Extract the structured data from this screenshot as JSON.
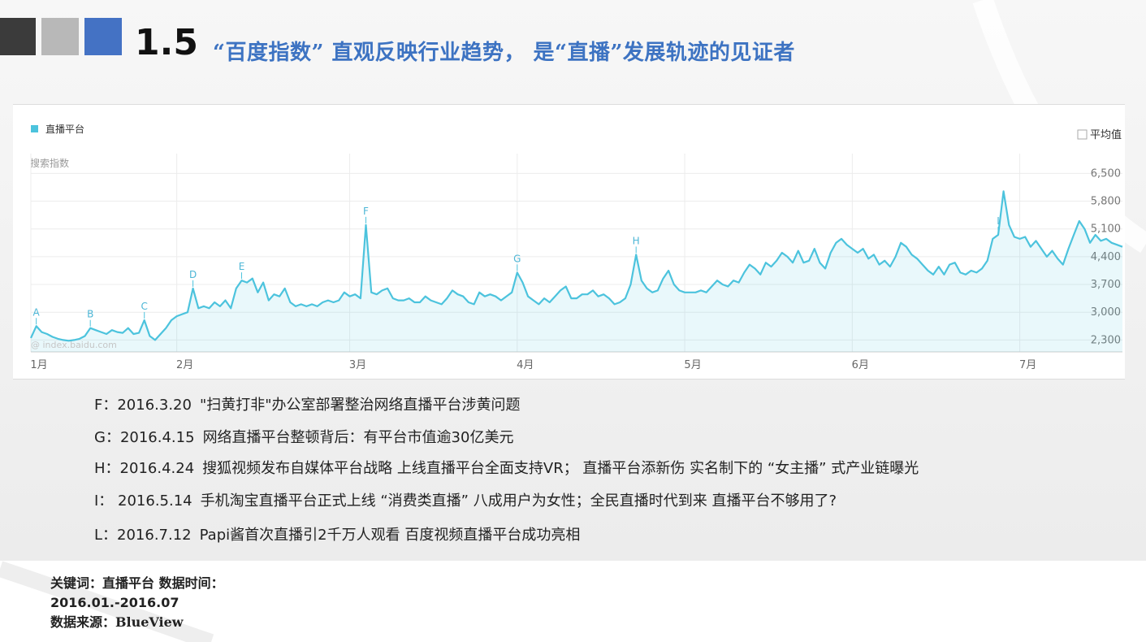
{
  "header": {
    "section_number": "1.5",
    "title": "“百度指数” 直观反映行业趋势， 是“直播”发展轨迹的见证者"
  },
  "chart_data": {
    "type": "area",
    "legend": {
      "series_label": "直播平台",
      "average_label": "平均值",
      "placement": "top-left"
    },
    "ylabel": "搜索指数",
    "watermark": "@ index.baidu.com",
    "grid": true,
    "ylim": [
      2000,
      7000
    ],
    "y_ticks": [
      6500,
      5800,
      5100,
      4400,
      3700,
      3000,
      2300
    ],
    "y_tick_labels": [
      "6,500",
      "5,800",
      "5,100",
      "4,400",
      "3,700",
      "3,000",
      "2,300"
    ],
    "x_range_days": [
      0,
      202
    ],
    "x_ticks": [
      {
        "day": 0,
        "label": "1月"
      },
      {
        "day": 27,
        "label": "2月"
      },
      {
        "day": 59,
        "label": "3月"
      },
      {
        "day": 90,
        "label": "4月"
      },
      {
        "day": 121,
        "label": "5月"
      },
      {
        "day": 152,
        "label": "6月"
      },
      {
        "day": 183,
        "label": "7月"
      }
    ],
    "series": [
      {
        "name": "直播平台",
        "color": "#4cc3dd",
        "points": [
          [
            0,
            2350
          ],
          [
            1,
            2650
          ],
          [
            2,
            2500
          ],
          [
            3,
            2450
          ],
          [
            4,
            2380
          ],
          [
            5,
            2330
          ],
          [
            6,
            2300
          ],
          [
            7,
            2280
          ],
          [
            8,
            2300
          ],
          [
            9,
            2330
          ],
          [
            10,
            2400
          ],
          [
            11,
            2600
          ],
          [
            12,
            2550
          ],
          [
            13,
            2500
          ],
          [
            14,
            2450
          ],
          [
            15,
            2550
          ],
          [
            16,
            2500
          ],
          [
            17,
            2480
          ],
          [
            18,
            2600
          ],
          [
            19,
            2450
          ],
          [
            20,
            2480
          ],
          [
            21,
            2800
          ],
          [
            22,
            2400
          ],
          [
            23,
            2300
          ],
          [
            24,
            2450
          ],
          [
            25,
            2600
          ],
          [
            26,
            2800
          ],
          [
            27,
            2900
          ],
          [
            28,
            2950
          ],
          [
            29,
            3000
          ],
          [
            30,
            3600
          ],
          [
            31,
            3100
          ],
          [
            32,
            3150
          ],
          [
            33,
            3100
          ],
          [
            34,
            3250
          ],
          [
            35,
            3150
          ],
          [
            36,
            3300
          ],
          [
            37,
            3100
          ],
          [
            38,
            3600
          ],
          [
            39,
            3800
          ],
          [
            40,
            3750
          ],
          [
            41,
            3850
          ],
          [
            42,
            3500
          ],
          [
            43,
            3750
          ],
          [
            44,
            3300
          ],
          [
            45,
            3450
          ],
          [
            46,
            3400
          ],
          [
            47,
            3600
          ],
          [
            48,
            3250
          ],
          [
            49,
            3150
          ],
          [
            50,
            3200
          ],
          [
            51,
            3150
          ],
          [
            52,
            3200
          ],
          [
            53,
            3150
          ],
          [
            54,
            3250
          ],
          [
            55,
            3300
          ],
          [
            56,
            3250
          ],
          [
            57,
            3300
          ],
          [
            58,
            3500
          ],
          [
            59,
            3400
          ],
          [
            60,
            3450
          ],
          [
            61,
            3350
          ],
          [
            62,
            5200
          ],
          [
            63,
            3500
          ],
          [
            64,
            3450
          ],
          [
            65,
            3550
          ],
          [
            66,
            3600
          ],
          [
            67,
            3350
          ],
          [
            68,
            3300
          ],
          [
            69,
            3300
          ],
          [
            70,
            3350
          ],
          [
            71,
            3250
          ],
          [
            72,
            3250
          ],
          [
            73,
            3400
          ],
          [
            74,
            3300
          ],
          [
            75,
            3250
          ],
          [
            76,
            3200
          ],
          [
            77,
            3350
          ],
          [
            78,
            3550
          ],
          [
            79,
            3450
          ],
          [
            80,
            3400
          ],
          [
            81,
            3250
          ],
          [
            82,
            3200
          ],
          [
            83,
            3500
          ],
          [
            84,
            3400
          ],
          [
            85,
            3450
          ],
          [
            86,
            3400
          ],
          [
            87,
            3300
          ],
          [
            88,
            3400
          ],
          [
            89,
            3500
          ],
          [
            90,
            4000
          ],
          [
            91,
            3750
          ],
          [
            92,
            3400
          ],
          [
            93,
            3300
          ],
          [
            94,
            3200
          ],
          [
            95,
            3350
          ],
          [
            96,
            3250
          ],
          [
            97,
            3400
          ],
          [
            98,
            3550
          ],
          [
            99,
            3650
          ],
          [
            100,
            3350
          ],
          [
            101,
            3350
          ],
          [
            102,
            3450
          ],
          [
            103,
            3450
          ],
          [
            104,
            3550
          ],
          [
            105,
            3400
          ],
          [
            106,
            3450
          ],
          [
            107,
            3350
          ],
          [
            108,
            3200
          ],
          [
            109,
            3250
          ],
          [
            110,
            3350
          ],
          [
            111,
            3700
          ],
          [
            112,
            4450
          ],
          [
            113,
            3800
          ],
          [
            114,
            3600
          ],
          [
            115,
            3500
          ],
          [
            116,
            3550
          ],
          [
            117,
            3850
          ],
          [
            118,
            4050
          ],
          [
            119,
            3700
          ],
          [
            120,
            3550
          ],
          [
            121,
            3500
          ],
          [
            122,
            3500
          ],
          [
            123,
            3500
          ],
          [
            124,
            3550
          ],
          [
            125,
            3500
          ],
          [
            126,
            3650
          ],
          [
            127,
            3800
          ],
          [
            128,
            3700
          ],
          [
            129,
            3650
          ],
          [
            130,
            3800
          ],
          [
            131,
            3750
          ],
          [
            132,
            4000
          ],
          [
            133,
            4200
          ],
          [
            134,
            4100
          ],
          [
            135,
            3950
          ],
          [
            136,
            4250
          ],
          [
            137,
            4150
          ],
          [
            138,
            4300
          ],
          [
            139,
            4500
          ],
          [
            140,
            4400
          ],
          [
            141,
            4250
          ],
          [
            142,
            4550
          ],
          [
            143,
            4250
          ],
          [
            144,
            4300
          ],
          [
            145,
            4600
          ],
          [
            146,
            4250
          ],
          [
            147,
            4100
          ],
          [
            148,
            4500
          ],
          [
            149,
            4750
          ],
          [
            150,
            4850
          ],
          [
            151,
            4700
          ],
          [
            152,
            4600
          ],
          [
            153,
            4500
          ],
          [
            154,
            4600
          ],
          [
            155,
            4350
          ],
          [
            156,
            4450
          ],
          [
            157,
            4200
          ],
          [
            158,
            4300
          ],
          [
            159,
            4150
          ],
          [
            160,
            4400
          ],
          [
            161,
            4750
          ],
          [
            162,
            4650
          ],
          [
            163,
            4450
          ],
          [
            164,
            4350
          ],
          [
            165,
            4200
          ],
          [
            166,
            4050
          ],
          [
            167,
            3950
          ],
          [
            168,
            4150
          ],
          [
            169,
            3950
          ],
          [
            170,
            4200
          ],
          [
            171,
            4250
          ],
          [
            172,
            4000
          ],
          [
            173,
            3950
          ],
          [
            174,
            4050
          ],
          [
            175,
            4000
          ],
          [
            176,
            4100
          ],
          [
            177,
            4300
          ],
          [
            178,
            4850
          ],
          [
            179,
            4950
          ],
          [
            180,
            6050
          ],
          [
            181,
            5200
          ],
          [
            182,
            4900
          ],
          [
            183,
            4850
          ],
          [
            184,
            4900
          ],
          [
            185,
            4650
          ],
          [
            186,
            4800
          ],
          [
            187,
            4600
          ],
          [
            188,
            4400
          ],
          [
            189,
            4550
          ],
          [
            190,
            4350
          ],
          [
            191,
            4200
          ],
          [
            192,
            4600
          ],
          [
            193,
            4950
          ],
          [
            194,
            5300
          ],
          [
            195,
            5100
          ],
          [
            196,
            4750
          ],
          [
            197,
            4950
          ],
          [
            198,
            4800
          ],
          [
            199,
            4850
          ],
          [
            200,
            4750
          ],
          [
            201,
            4700
          ],
          [
            202,
            4650
          ]
        ]
      }
    ],
    "annotations": [
      {
        "label": "A",
        "day": 1,
        "value": 2650
      },
      {
        "label": "B",
        "day": 11,
        "value": 2600
      },
      {
        "label": "C",
        "day": 21,
        "value": 2800
      },
      {
        "label": "D",
        "day": 30,
        "value": 3600
      },
      {
        "label": "E",
        "day": 39,
        "value": 3800
      },
      {
        "label": "F",
        "day": 62,
        "value": 5200
      },
      {
        "label": "G",
        "day": 90,
        "value": 4000
      },
      {
        "label": "H",
        "day": 112,
        "value": 4450
      },
      {
        "label": "I",
        "day": 179,
        "value": 4950
      }
    ]
  },
  "notes": [
    {
      "label": "F：2016.3.20",
      "text": "\"扫黄打非\"办公室部署整治网络直播平台涉黄问题"
    },
    {
      "label": "G：2016.4.15",
      "text": "网络直播平台整顿背后：有平台市值逾30亿美元"
    },
    {
      "label": "H：2016.4.24",
      "text": "搜狐视频发布自媒体平台战略 上线直播平台全面支持VR； 直播平台添新伤 实名制下的 “女主播” 式产业链曝光"
    },
    {
      "label": "I： 2016.5.14",
      "text": "手机淘宝直播平台正式上线 “消费类直播” 八成用户为女性；全民直播时代到来 直播平台不够用了?"
    },
    {
      "label": "L：2016.7.12",
      "text": "Papi酱首次直播引2千万人观看 百度视频直播平台成功亮相"
    }
  ],
  "footer": {
    "keywords": "关键词：直播平台 数据时间：",
    "time_range": "2016.01.-2016.07",
    "source": "数据来源：BlueView"
  },
  "colors": {
    "accent_blue": "#4472c4",
    "title_blue": "#3d73c2",
    "series": "#4cc3dd"
  }
}
